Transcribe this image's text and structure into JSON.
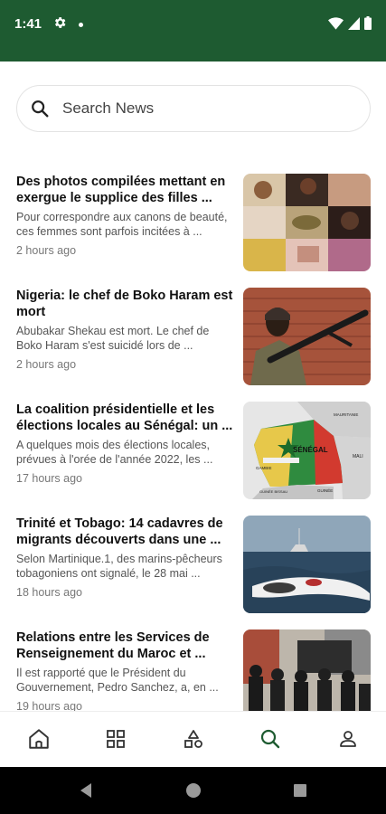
{
  "status": {
    "time": "1:41",
    "icons": [
      "gear-icon",
      "dot-icon",
      "wifi-icon",
      "cell-signal-icon",
      "battery-icon"
    ]
  },
  "search": {
    "placeholder": "Search News",
    "icon": "search-icon"
  },
  "articles": [
    {
      "title": "Des photos compilées mettant en exergue le supplice des filles ...",
      "excerpt": "Pour correspondre aux canons de beauté, ces femmes sont parfois incitées à ...",
      "time": "2 hours ago"
    },
    {
      "title": "Nigeria: le chef de Boko Haram est mort",
      "excerpt": "Abubakar Shekau est mort. Le chef de Boko Haram s'est suicidé lors de ...",
      "time": "2 hours ago"
    },
    {
      "title": "La coalition présidentielle et les élections locales au Sénégal: un ...",
      "excerpt": "A quelques mois des élections locales, prévues à l'orée de l'année 2022, les ...",
      "time": "17 hours ago",
      "map_labels": {
        "country": "SÉNÉGAL",
        "mauritania": "MAURITANIE",
        "mali": "MALI",
        "gambia": "GAMBIE",
        "guinea": "GUINÉE",
        "guinea_bissau": "GUINÉE BISSAU"
      }
    },
    {
      "title": "Trinité et Tobago: 14 cadavres de migrants découverts dans une ...",
      "excerpt": "Selon Martinique.1, des marins-pêcheurs tobagoniens ont signalé, le 28 mai ...",
      "time": "18 hours ago"
    },
    {
      "title": "Relations entre les Services de Renseignement du Maroc et ...",
      "excerpt": "Il est rapporté que le Président du Gouvernement, Pedro Sanchez, a, en ...",
      "time": "19 hours ago"
    }
  ],
  "bottom_nav": [
    {
      "name": "home-icon",
      "active": false
    },
    {
      "name": "grid-icon",
      "active": false
    },
    {
      "name": "shapes-icon",
      "active": false
    },
    {
      "name": "search-icon",
      "active": true
    },
    {
      "name": "profile-icon",
      "active": false
    }
  ],
  "colors": {
    "brand": "#1e5b31",
    "active_nav": "#1e5b31",
    "inactive_nav": "#333333"
  }
}
